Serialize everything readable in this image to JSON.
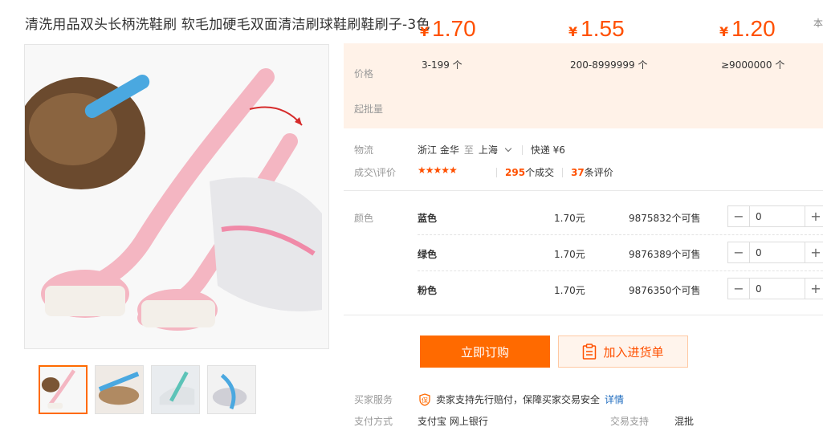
{
  "title": "清洗用品双头长柄洗鞋刷 软毛加硬毛双面清洁刷球鞋刷鞋刷子-3色",
  "corner_text": "本",
  "gallery": {
    "thumb_count": 4,
    "active_index": 0
  },
  "price": {
    "price_label": "价格",
    "batch_label": "起批量",
    "currency": "¥",
    "tiers": [
      {
        "price": "1.70",
        "range": "3-199 个"
      },
      {
        "price": "1.55",
        "range": "200-8999999 个"
      },
      {
        "price": "1.20",
        "range": "≥9000000 个"
      }
    ]
  },
  "logistics": {
    "label": "物流",
    "origin": "浙江 金华",
    "to": "至",
    "destination": "上海",
    "shipping": "快递 ¥6"
  },
  "deals": {
    "label": "成交\\评价",
    "stars": "★★★★★",
    "deal_count": "295",
    "deal_suffix": "个成交",
    "review_count": "37",
    "review_suffix": "条评价"
  },
  "sku": {
    "label": "颜色",
    "items": [
      {
        "name": "蓝色",
        "price": "1.70元",
        "stock": "9875832个可售",
        "qty": "0"
      },
      {
        "name": "绿色",
        "price": "1.70元",
        "stock": "9876389个可售",
        "qty": "0"
      },
      {
        "name": "粉色",
        "price": "1.70元",
        "stock": "9876350个可售",
        "qty": "0"
      }
    ]
  },
  "actions": {
    "order": "立即订购",
    "add_cart": "加入进货单"
  },
  "service": {
    "buyer_label": "买家服务",
    "guarantee": "卖家支持先行赔付，保障买家交易安全",
    "detail_link": "详情",
    "pay_label": "支付方式",
    "pay_methods": "支付宝  网上银行",
    "trade_label": "交易支持",
    "trade_value": "混批"
  },
  "colors": {
    "accent": "#ff6a00",
    "price": "#ff5000",
    "price_bg": "#fff2e8",
    "link": "#1f6cbf"
  }
}
